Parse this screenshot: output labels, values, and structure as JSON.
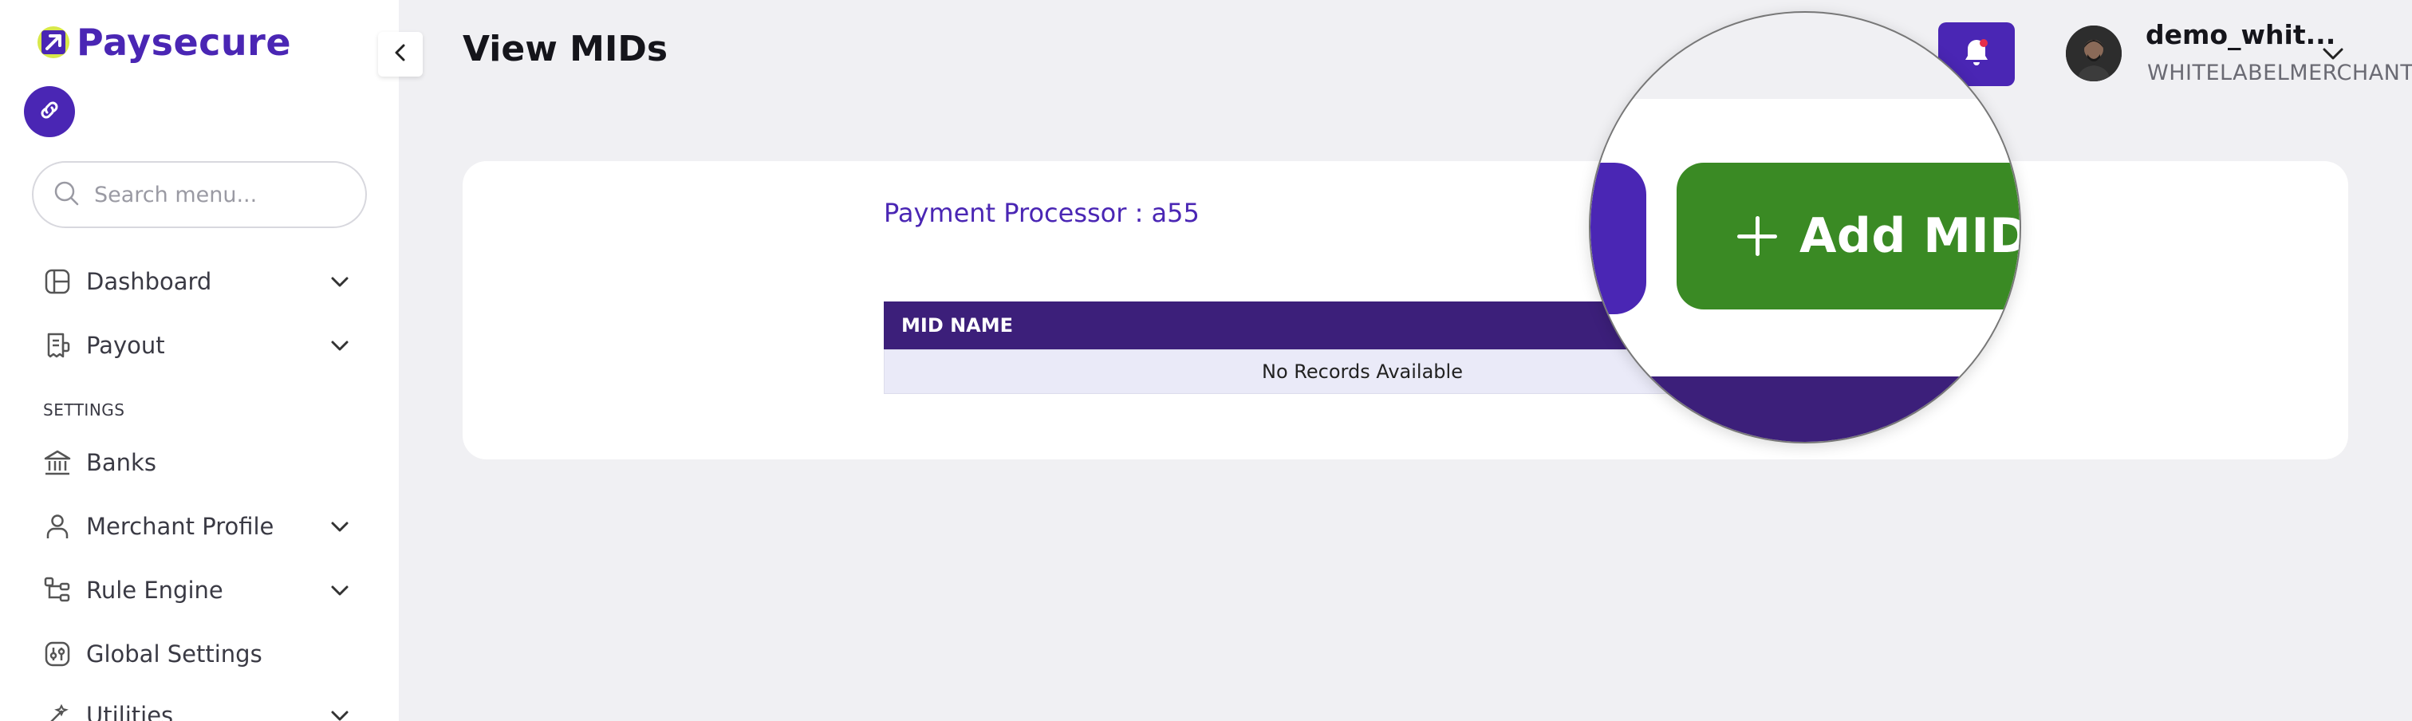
{
  "brand": {
    "name": "Paysecure"
  },
  "search": {
    "placeholder": "Search menu..."
  },
  "nav": {
    "items": [
      {
        "label": "Dashboard",
        "icon": "dashboard-icon",
        "expandable": true
      },
      {
        "label": "Payout",
        "icon": "payout-icon",
        "expandable": true
      }
    ],
    "settings_label": "SETTINGS",
    "settings_items": [
      {
        "label": "Banks",
        "icon": "bank-icon",
        "expandable": false
      },
      {
        "label": "Merchant Profile",
        "icon": "user-icon",
        "expandable": true
      },
      {
        "label": "Rule Engine",
        "icon": "rule-engine-icon",
        "expandable": true
      },
      {
        "label": "Global Settings",
        "icon": "global-settings-icon",
        "expandable": false
      },
      {
        "label": "Utilities",
        "icon": "utilities-icon",
        "expandable": true
      }
    ]
  },
  "header": {
    "title": "View MIDs",
    "user": {
      "name": "demo_whit...",
      "role": "WHITELABELMERCHANT"
    }
  },
  "main": {
    "processor_label": "Payment Processor : a55",
    "table": {
      "columns": [
        "MID NAME"
      ],
      "empty_message": "No Records Available"
    }
  },
  "magnifier": {
    "add_button_label": "Add MID"
  },
  "colors": {
    "brand_purple": "#4a26b4",
    "table_header": "#3c1f7a",
    "add_button_green": "#3a8a24",
    "background": "#f0f0f3"
  }
}
